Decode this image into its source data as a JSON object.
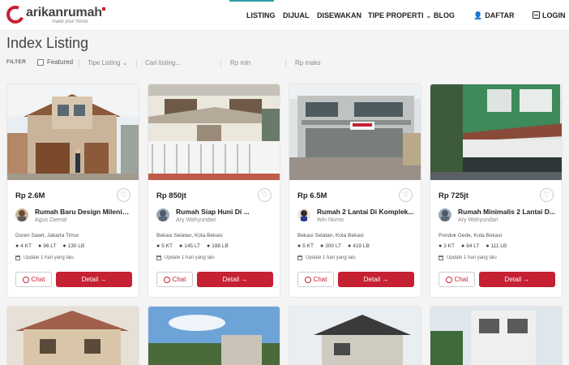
{
  "header": {
    "brand": "arikanrumah",
    "tagline": "make your home",
    "nav": {
      "listing": "LISTING",
      "dijual": "DIJUAL",
      "disewakan": "DISEWAKAN",
      "tipe": "TIPE PROPERTI",
      "blog": "BLOG",
      "daftar": "DAFTAR",
      "login": "LOGIN"
    }
  },
  "page": {
    "title": "Index Listing"
  },
  "filter": {
    "label": "FILTER",
    "featured": "Featured",
    "tipe_listing": "Tipe Listing",
    "search_placeholder": "Cari listing...",
    "min_placeholder": "Rp min",
    "max_placeholder": "Rp maks"
  },
  "listings": [
    {
      "price": "Rp 2.6M",
      "title": "Rumah Baru Design Milenial...",
      "agent": "Agus Zaenal",
      "location": "Duren Sawit, Jakarta Timur",
      "kt": "4 KT",
      "lt": "96 LT",
      "lb": "130 LB",
      "updated": "Update 1 hari yang lalu",
      "chat": "Chat",
      "detail": "Detail →"
    },
    {
      "price": "Rp 850jt",
      "title": "Rumah Siap Huni Di ...",
      "agent": "Ary Wahyundari",
      "location": "Bekasi Selatan, Kota Bekasi",
      "kt": "5 KT",
      "lt": "145 LT",
      "lb": "188 LB",
      "updated": "Update 1 hari yang lalu",
      "chat": "Chat",
      "detail": "Detail →"
    },
    {
      "price": "Rp 6.5M",
      "title": "Rumah 2 Lantai Di Komplek...",
      "agent": "Win Norno",
      "location": "Bekasi Selatan, Kota Bekasi",
      "kt": "5 KT",
      "lt": "300 LT",
      "lb": "419 LB",
      "updated": "Update 1 hari yang lalu",
      "chat": "Chat",
      "detail": "Detail →"
    },
    {
      "price": "Rp 725jt",
      "title": "Rumah Minimalis 2 Lantai D...",
      "agent": "Ary Wahyundari",
      "location": "Pondok Gede, Kota Bekasi",
      "kt": "3 KT",
      "lt": "84 LT",
      "lb": "111 LB",
      "updated": "Update 1 hari yang lalu",
      "chat": "Chat",
      "detail": "Detail →"
    }
  ],
  "colors": {
    "brand_red": "#c62033",
    "accent_teal": "#2f9fa8"
  }
}
